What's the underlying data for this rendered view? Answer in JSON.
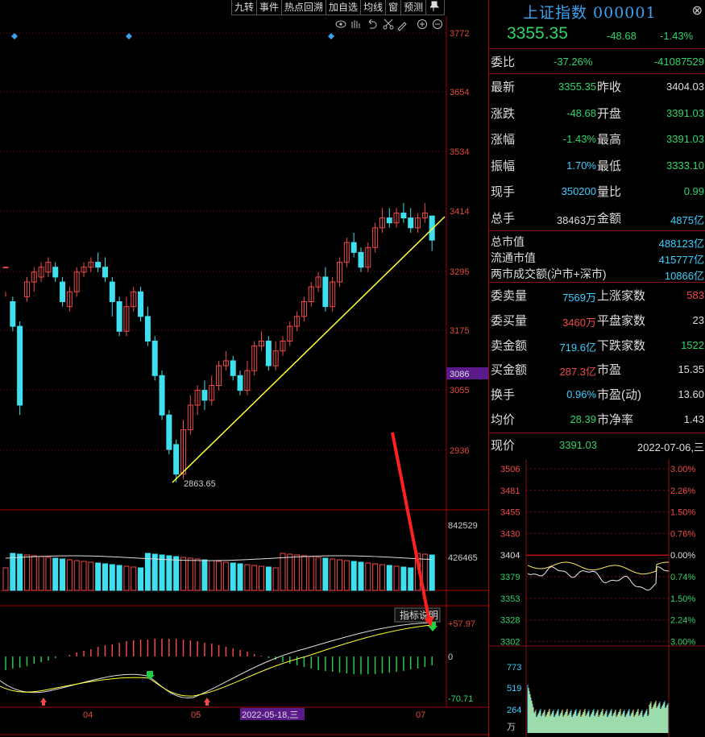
{
  "toolbar": {
    "buttons": [
      "九转",
      "事件",
      "热点回溯",
      "加自选",
      "均线",
      "窗",
      "预测"
    ],
    "pin_icon": "pin-icon"
  },
  "chart": {
    "price_ticks": [
      "3772",
      "3654",
      "3534",
      "3414",
      "3295",
      "3175",
      "3055",
      "2936"
    ],
    "current_marker": "3086",
    "low_label": "2863.65",
    "vol_ticks": [
      "842529",
      "426465"
    ],
    "macd_ticks": [
      "+57.97",
      "0",
      "-70.71"
    ],
    "x_labels": [
      "04",
      "05",
      "07"
    ],
    "x_highlight": "2022-05-18,三",
    "indicator_button": "指标说明",
    "colors": {
      "up": "#f04a4a",
      "down": "#3ee0f0",
      "trend": "#ffff33",
      "grid": "#7a1010"
    }
  },
  "chart_data": {
    "type": "candlestick",
    "title": "",
    "ylim": [
      2830,
      3800
    ],
    "candles": [
      [
        3300,
        3300,
        3250,
        3240
      ],
      [
        3230,
        3180,
        3240,
        3170
      ],
      [
        3180,
        3020,
        3190,
        3000
      ],
      [
        3240,
        3270,
        3280,
        3230
      ],
      [
        3270,
        3290,
        3300,
        3250
      ],
      [
        3280,
        3300,
        3310,
        3270
      ],
      [
        3290,
        3310,
        3320,
        3280
      ],
      [
        3300,
        3280,
        3310,
        3270
      ],
      [
        3270,
        3230,
        3280,
        3220
      ],
      [
        3220,
        3250,
        3260,
        3210
      ],
      [
        3250,
        3290,
        3300,
        3240
      ],
      [
        3290,
        3300,
        3310,
        3280
      ],
      [
        3300,
        3310,
        3320,
        3290
      ],
      [
        3310,
        3300,
        3330,
        3290
      ],
      [
        3300,
        3280,
        3320,
        3270
      ],
      [
        3270,
        3230,
        3280,
        3200
      ],
      [
        3230,
        3170,
        3240,
        3160
      ],
      [
        3170,
        3220,
        3240,
        3160
      ],
      [
        3220,
        3250,
        3260,
        3210
      ],
      [
        3250,
        3200,
        3260,
        3190
      ],
      [
        3200,
        3150,
        3220,
        3140
      ],
      [
        3150,
        3080,
        3160,
        3070
      ],
      [
        3080,
        3000,
        3090,
        2990
      ],
      [
        3000,
        2930,
        3010,
        2920
      ],
      [
        2940,
        2880,
        2950,
        2863
      ],
      [
        2880,
        2970,
        2990,
        2870
      ],
      [
        2970,
        3020,
        3040,
        2960
      ],
      [
        3020,
        3050,
        3060,
        3000
      ],
      [
        3050,
        3030,
        3070,
        3010
      ],
      [
        3030,
        3060,
        3080,
        3020
      ],
      [
        3060,
        3100,
        3110,
        3050
      ],
      [
        3100,
        3110,
        3130,
        3090
      ],
      [
        3110,
        3080,
        3120,
        3070
      ],
      [
        3080,
        3050,
        3090,
        3040
      ],
      [
        3050,
        3090,
        3110,
        3040
      ],
      [
        3090,
        3140,
        3150,
        3080
      ],
      [
        3140,
        3150,
        3170,
        3130
      ],
      [
        3150,
        3100,
        3160,
        3090
      ],
      [
        3100,
        3130,
        3150,
        3090
      ],
      [
        3130,
        3150,
        3160,
        3120
      ],
      [
        3150,
        3180,
        3190,
        3140
      ],
      [
        3180,
        3200,
        3210,
        3170
      ],
      [
        3200,
        3230,
        3240,
        3190
      ],
      [
        3230,
        3260,
        3270,
        3220
      ],
      [
        3260,
        3280,
        3290,
        3250
      ],
      [
        3280,
        3220,
        3300,
        3210
      ],
      [
        3220,
        3270,
        3280,
        3210
      ],
      [
        3270,
        3310,
        3320,
        3260
      ],
      [
        3310,
        3350,
        3360,
        3300
      ],
      [
        3350,
        3330,
        3370,
        3320
      ],
      [
        3330,
        3300,
        3340,
        3290
      ],
      [
        3300,
        3340,
        3350,
        3290
      ],
      [
        3340,
        3380,
        3390,
        3330
      ],
      [
        3380,
        3400,
        3420,
        3370
      ],
      [
        3400,
        3390,
        3420,
        3380
      ],
      [
        3390,
        3410,
        3420,
        3380
      ],
      [
        3410,
        3400,
        3430,
        3390
      ],
      [
        3400,
        3380,
        3420,
        3370
      ],
      [
        3380,
        3400,
        3410,
        3370
      ],
      [
        3400,
        3410,
        3430,
        3390
      ],
      [
        3404,
        3355,
        3391,
        3333
      ]
    ]
  },
  "panel": {
    "title": "上证指数 000001",
    "close_icon": "close-icon",
    "price": "3355.35",
    "change": "-48.68",
    "change_pct": "-1.43%",
    "weibi": {
      "label": "委比",
      "v1": "-37.26%",
      "v2": "-41087529"
    },
    "rows": [
      {
        "l1": "最新",
        "v1": "3355.35",
        "c1": "g",
        "l2": "昨收",
        "v2": "3404.03",
        "c2": "w"
      },
      {
        "l1": "涨跌",
        "v1": "-48.68",
        "c1": "g",
        "l2": "开盘",
        "v2": "3391.03",
        "c2": "g"
      },
      {
        "l1": "涨幅",
        "v1": "-1.43%",
        "c1": "g",
        "l2": "最高",
        "v2": "3391.03",
        "c2": "g"
      },
      {
        "l1": "振幅",
        "v1": "1.70%",
        "c1": "b",
        "l2": "最低",
        "v2": "3333.10",
        "c2": "g"
      },
      {
        "l1": "现手",
        "v1": "350200",
        "c1": "b",
        "l2": "量比",
        "v2": "0.99",
        "c2": "g"
      },
      {
        "l1": "总手",
        "v1": "38463万",
        "c1": "w",
        "l2": "金额",
        "v2": "4875亿",
        "c2": "b"
      }
    ],
    "mkt": [
      {
        "l": "总市值",
        "v": "488123亿"
      },
      {
        "l": "流通市值",
        "v": "415777亿"
      },
      {
        "l": "两市成交额(沪市+深市)",
        "v": "10866亿"
      }
    ],
    "rows2": [
      {
        "l1": "委卖量",
        "v1": "7569万",
        "c1": "b",
        "l2": "上涨家数",
        "v2": "583",
        "c2": "red"
      },
      {
        "l1": "委买量",
        "v1": "3460万",
        "c1": "red",
        "l2": "平盘家数",
        "v2": "23",
        "c2": "w"
      },
      {
        "l1": "卖金额",
        "v1": "719.6亿",
        "c1": "b",
        "l2": "下跌家数",
        "v2": "1522",
        "c2": "g"
      },
      {
        "l1": "买金额",
        "v1": "287.3亿",
        "c1": "red",
        "l2": "市盈",
        "v2": "15.35",
        "c2": "w"
      },
      {
        "l1": "换手",
        "v1": "0.96%",
        "c1": "b",
        "l2": "市盈(动)",
        "v2": "13.60",
        "c2": "w"
      },
      {
        "l1": "均价",
        "v1": "28.39",
        "c1": "g",
        "l2": "市净率",
        "v2": "1.43",
        "c2": "w"
      }
    ],
    "now": {
      "label": "现价",
      "value": "3391.03",
      "date": "2022-07-06,三"
    },
    "mini": {
      "left_ticks": [
        "3506",
        "3481",
        "3455",
        "3430",
        "3404",
        "3379",
        "3353",
        "3328",
        "3302"
      ],
      "right_ticks": [
        "3.00%",
        "2.26%",
        "1.50%",
        "0.76%",
        "0.00%",
        "0.74%",
        "1.50%",
        "2.24%",
        "3.00%"
      ],
      "vol_ticks": [
        "773",
        "519",
        "264",
        "万"
      ]
    }
  }
}
